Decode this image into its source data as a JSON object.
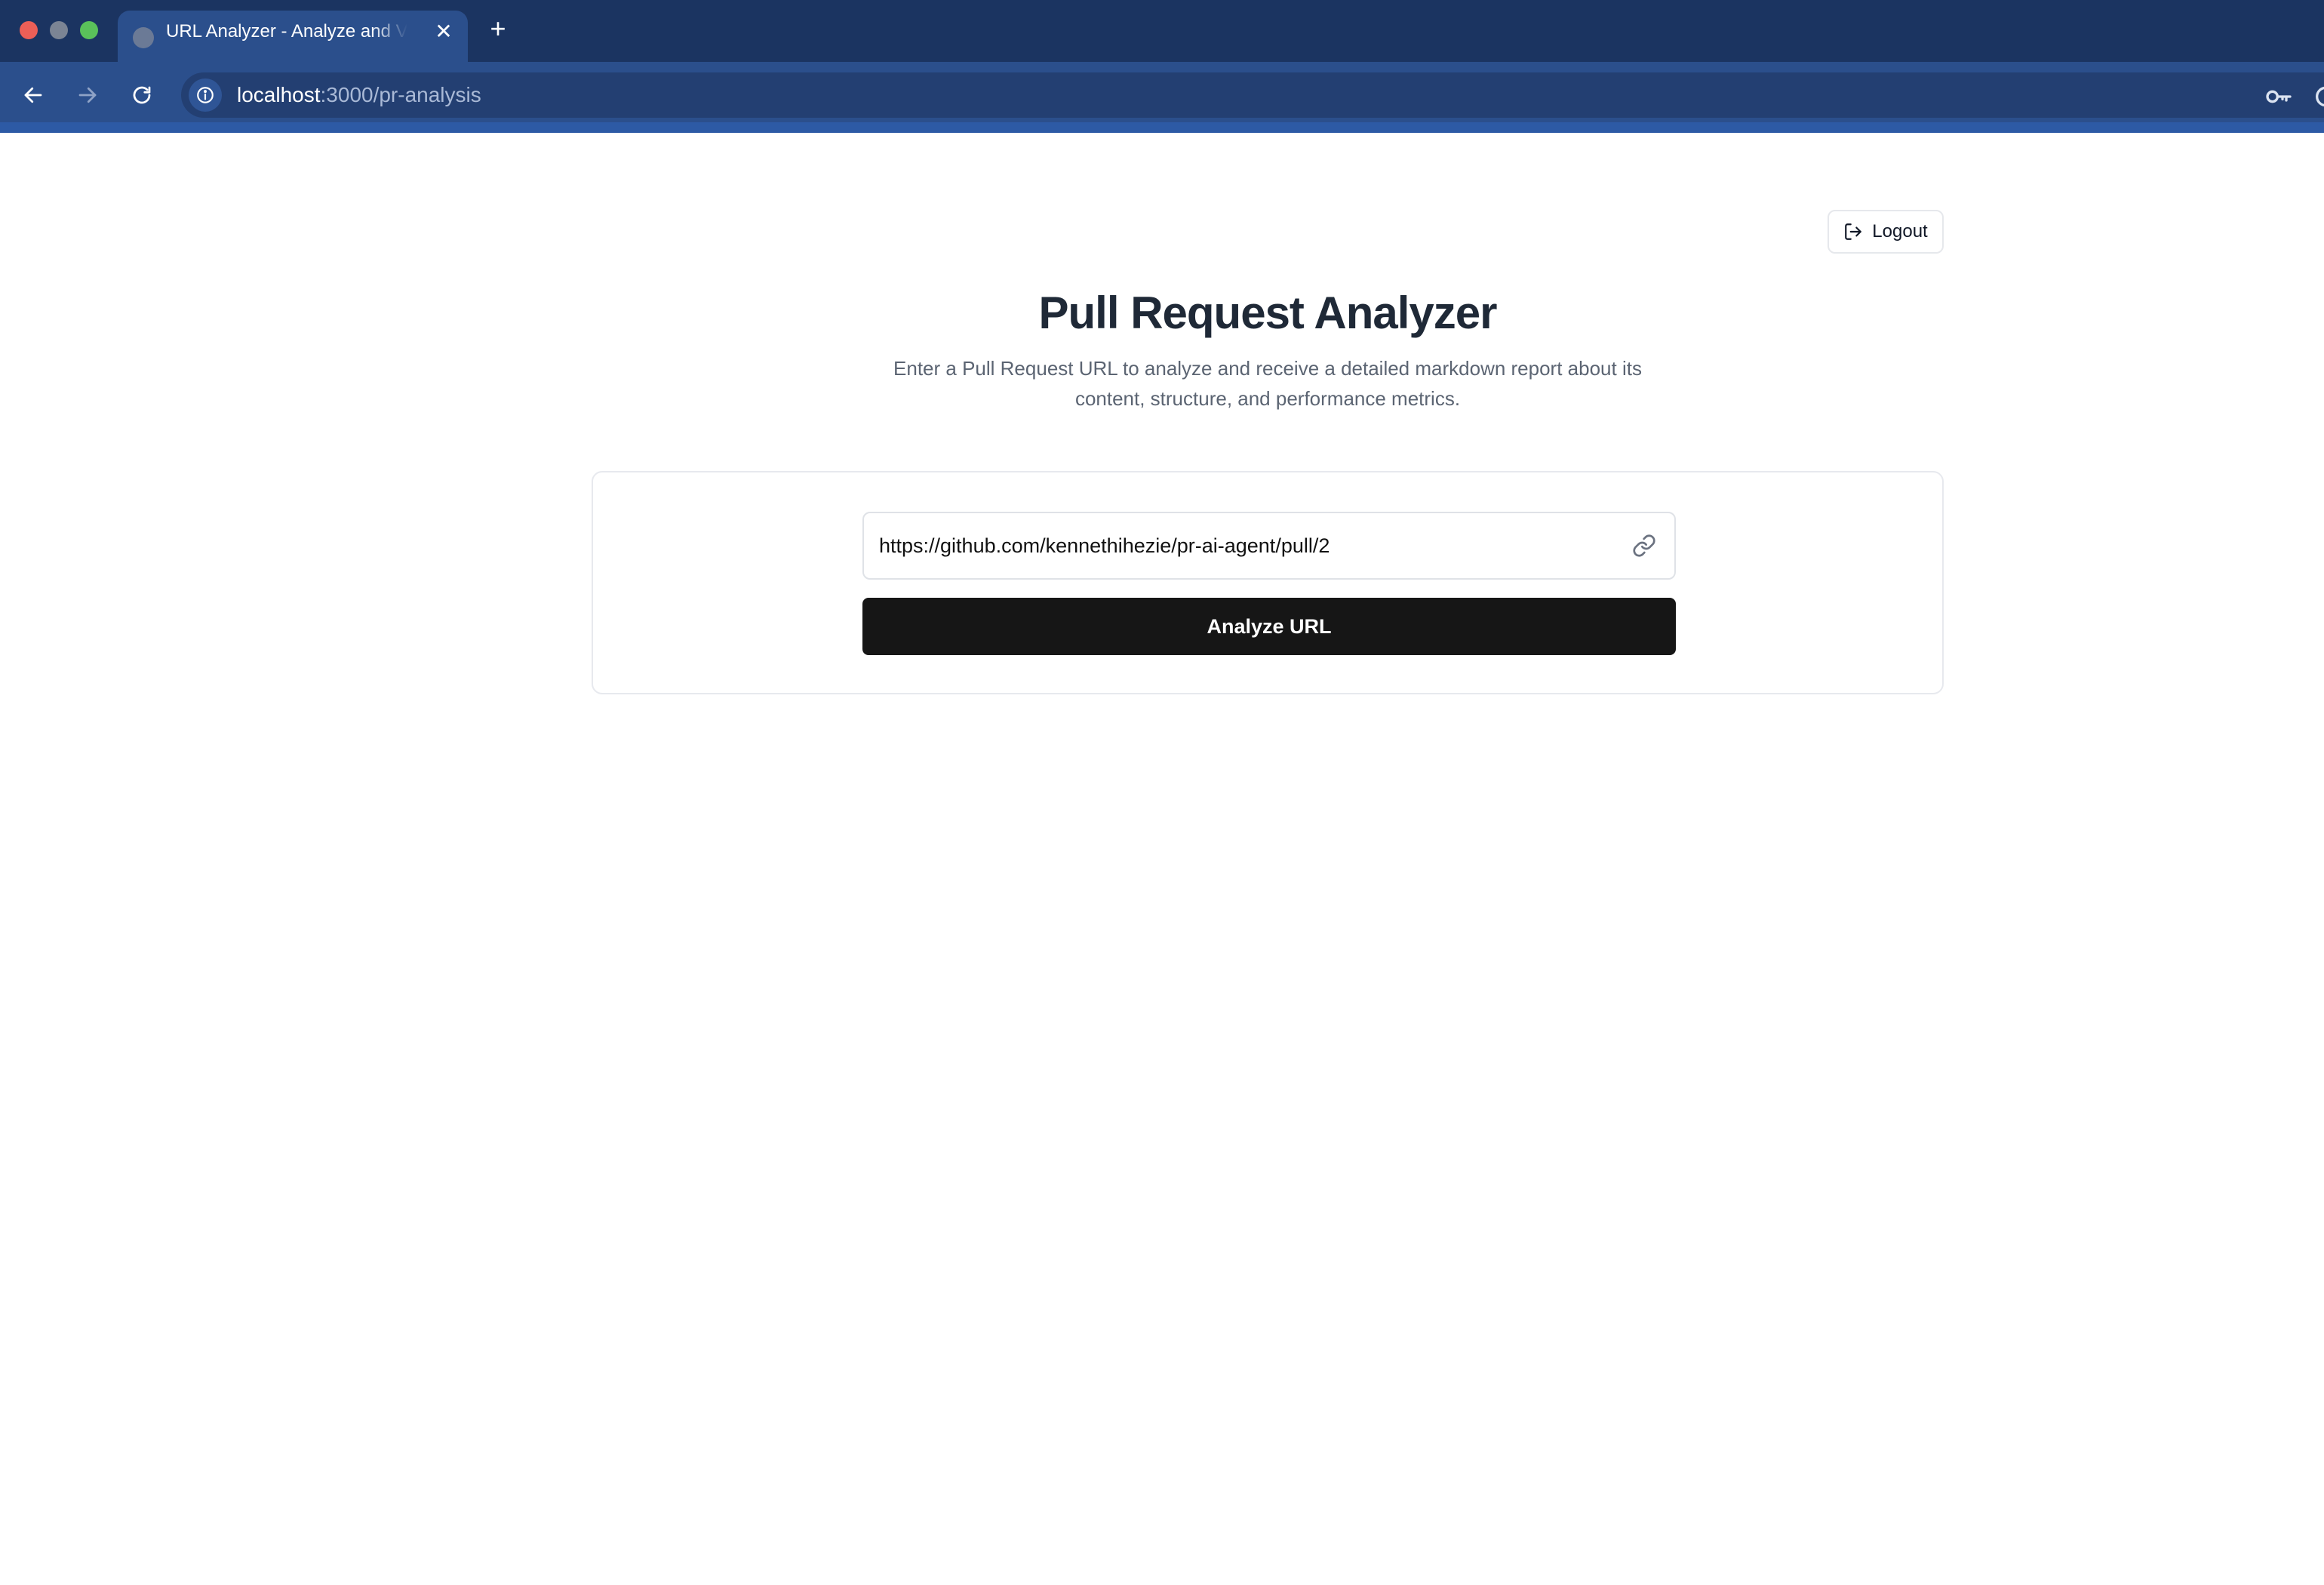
{
  "browser": {
    "tab": {
      "title": "URL Analyzer - Analyze and Visualize",
      "favicon": "globe-icon",
      "close_glyph": "✕"
    },
    "new_tab_glyph": "+",
    "address": {
      "host": "localhost",
      "path": ":3000/pr-analysis"
    },
    "colors": {
      "tabbar": "#1b3461",
      "toolbar": "#2b4f8c",
      "accent": "#2d5aa5"
    }
  },
  "page": {
    "logout_label": "Logout",
    "title": "Pull Request Analyzer",
    "subtitle": "Enter a Pull Request URL to analyze and receive a detailed markdown report about its content, structure, and performance metrics.",
    "form": {
      "url_value": "https://github.com/kennethihezie/pr-ai-agent/pull/2",
      "submit_label": "Analyze URL"
    },
    "colors": {
      "button": "#161616",
      "title": "#1f2937",
      "subtitle": "#5b6472"
    }
  }
}
